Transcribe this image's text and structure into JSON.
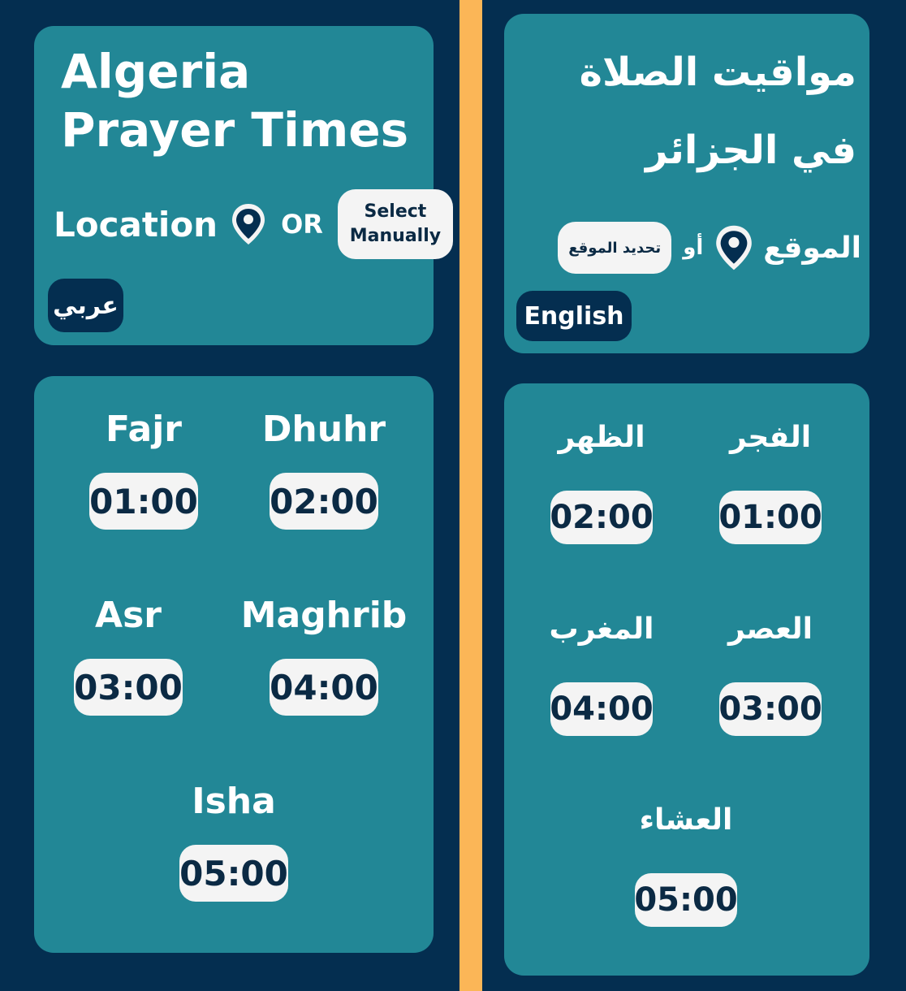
{
  "english_view": {
    "title": "Algeria Prayer Times",
    "location_label": "Location",
    "or_label": "OR",
    "select_button": "Select Manually",
    "language_button": "عربي",
    "prayers": [
      {
        "name": "Fajr",
        "time": "01:00"
      },
      {
        "name": "Dhuhr",
        "time": "02:00"
      },
      {
        "name": "Asr",
        "time": "03:00"
      },
      {
        "name": "Maghrib",
        "time": "04:00"
      },
      {
        "name": "Isha",
        "time": "05:00"
      }
    ]
  },
  "arabic_view": {
    "title": "مواقيت الصلاة في الجزائر",
    "location_label": "الموقع",
    "or_label": "أو",
    "select_button": "تحديد الموقع",
    "language_button": "English",
    "prayers": [
      {
        "name": "الفجر",
        "time": "01:00"
      },
      {
        "name": "الظهر",
        "time": "02:00"
      },
      {
        "name": "العصر",
        "time": "03:00"
      },
      {
        "name": "المغرب",
        "time": "04:00"
      },
      {
        "name": "العشاء",
        "time": "05:00"
      }
    ]
  },
  "icons": {
    "location": "location-pin-icon"
  },
  "colors": {
    "background": "#042e50",
    "card": "#228796",
    "divider": "#fbb657",
    "time_box": "#f4f4f4",
    "time_text": "#0b2a44"
  }
}
